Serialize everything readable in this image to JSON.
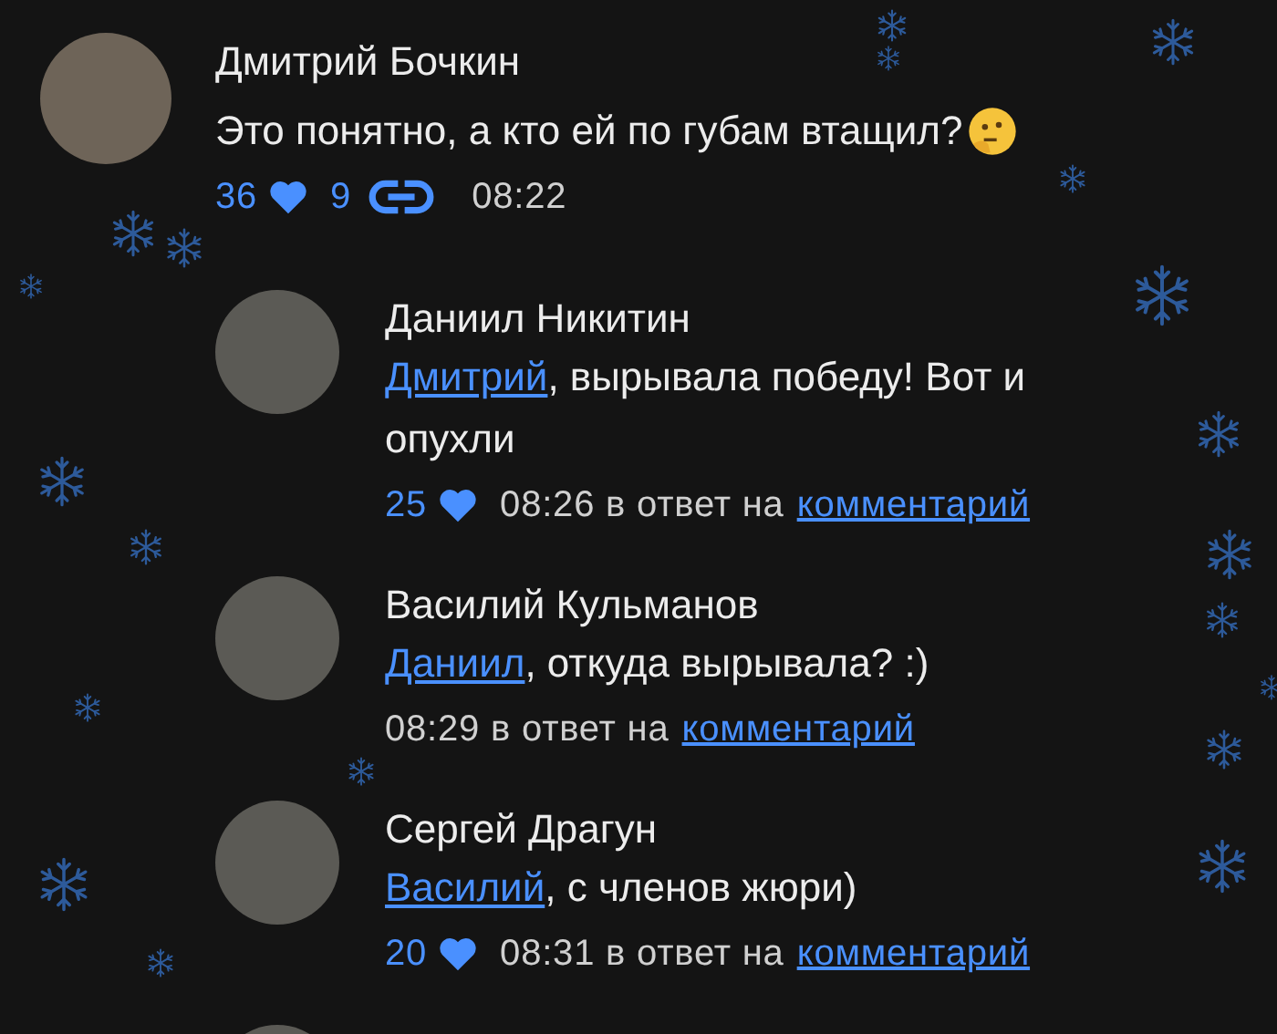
{
  "comment": {
    "author": "Дмитрий Бочкин",
    "text": "Это понятно, а кто ей по губам втащил?",
    "likes": "36",
    "replies": "9",
    "time": "08:22"
  },
  "replies": [
    {
      "author": "Даниил Никитин",
      "mention": "Дмитрий",
      "text": ", вырывала победу! Вот и опухли",
      "likes": "25",
      "time": "08:26",
      "reply_prefix": "в ответ на",
      "reply_link": "комментарий"
    },
    {
      "author": "Василий Кульманов",
      "mention": "Даниил",
      "text": ", откуда вырывала? :)",
      "time": "08:29",
      "reply_prefix": "в ответ на",
      "reply_link": "комментарий"
    },
    {
      "author": "Сергей Драгун",
      "mention": "Василий",
      "text": ", с членов жюри)",
      "likes": "20",
      "time": "08:31",
      "reply_prefix": "в ответ на",
      "reply_link": "комментарий"
    }
  ]
}
